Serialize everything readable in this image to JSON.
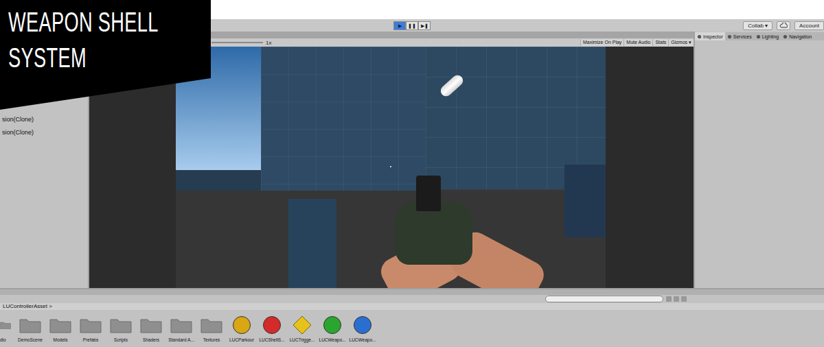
{
  "overlay": {
    "title_lines": [
      "WEAPON SHELL",
      "SYSTEM"
    ]
  },
  "toolbar": {
    "play_buttons": [
      {
        "icon": "▶",
        "selected": true
      },
      {
        "icon": "❚❚",
        "selected": false
      },
      {
        "icon": "▶❚",
        "selected": false
      }
    ],
    "collab": "Collab ▾",
    "account": "Account"
  },
  "hierarchy": {
    "items": [
      "sion(Clone)",
      "sion(Clone)"
    ]
  },
  "game_view": {
    "scale_label": "1x",
    "buttons": [
      {
        "label": "Maximize On Play",
        "selected": false
      },
      {
        "label": "Mute Audio",
        "selected": false
      },
      {
        "label": "Stats",
        "selected": false
      },
      {
        "label": "Gizmos ▾",
        "selected": false
      }
    ]
  },
  "inspector": {
    "tabs": [
      {
        "label": "Inspector",
        "selected": true
      },
      {
        "label": "Services",
        "selected": false
      },
      {
        "label": "Lighting",
        "selected": false
      },
      {
        "label": "Navigation",
        "selected": false
      }
    ]
  },
  "project": {
    "breadcrumb": "LUControllerAsset >",
    "search": {
      "placeholder": ""
    },
    "items": [
      {
        "name": "dio",
        "kind": "folder",
        "color": "#8f8f8f"
      },
      {
        "name": "DemoScene",
        "kind": "folder",
        "color": "#8f8f8f"
      },
      {
        "name": "Models",
        "kind": "folder",
        "color": "#8f8f8f"
      },
      {
        "name": "Prefabs",
        "kind": "folder",
        "color": "#8f8f8f"
      },
      {
        "name": "Scripts",
        "kind": "folder",
        "color": "#8f8f8f"
      },
      {
        "name": "Shaders",
        "kind": "folder",
        "color": "#8f8f8f"
      },
      {
        "name": "Standard A...",
        "kind": "folder",
        "color": "#8f8f8f"
      },
      {
        "name": "Textures",
        "kind": "folder",
        "color": "#8f8f8f"
      },
      {
        "name": "LUCParkour",
        "kind": "circle",
        "color": "#d9a614"
      },
      {
        "name": "LUCShellS...",
        "kind": "circle",
        "color": "#d42a2a"
      },
      {
        "name": "LUCTrigge...",
        "kind": "diamond",
        "color": "#e6c21a"
      },
      {
        "name": "LUCWeapo...",
        "kind": "circle",
        "color": "#2aa52f"
      },
      {
        "name": "LUCWeapo...",
        "kind": "circle",
        "color": "#2a6fd0"
      }
    ]
  }
}
